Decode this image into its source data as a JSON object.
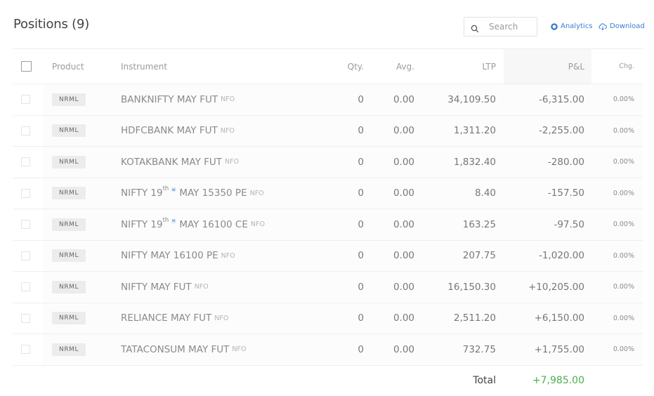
{
  "header": {
    "title": "Positions (9)",
    "search_placeholder": "Search",
    "analytics_label": "Analytics",
    "download_label": "Download"
  },
  "table": {
    "columns": {
      "product": "Product",
      "instrument": "Instrument",
      "qty": "Qty.",
      "avg": "Avg.",
      "ltp": "LTP",
      "pnl": "P&L",
      "chg": "Chg."
    },
    "rows": [
      {
        "product": "NRML",
        "pre": "BANKNIFTY MAY FUT",
        "sup": "",
        "weekly": false,
        "post": "",
        "exchange": "NFO",
        "qty": "0",
        "avg": "0.00",
        "ltp": "34,109.50",
        "pnl": "-6,315.00",
        "chg": "0.00%"
      },
      {
        "product": "NRML",
        "pre": "HDFCBANK MAY FUT",
        "sup": "",
        "weekly": false,
        "post": "",
        "exchange": "NFO",
        "qty": "0",
        "avg": "0.00",
        "ltp": "1,311.20",
        "pnl": "-2,255.00",
        "chg": "0.00%"
      },
      {
        "product": "NRML",
        "pre": "KOTAKBANK MAY FUT",
        "sup": "",
        "weekly": false,
        "post": "",
        "exchange": "NFO",
        "qty": "0",
        "avg": "0.00",
        "ltp": "1,832.40",
        "pnl": "-280.00",
        "chg": "0.00%"
      },
      {
        "product": "NRML",
        "pre": "NIFTY 19",
        "sup": "th",
        "weekly": true,
        "post": "MAY 15350 PE",
        "exchange": "NFO",
        "qty": "0",
        "avg": "0.00",
        "ltp": "8.40",
        "pnl": "-157.50",
        "chg": "0.00%"
      },
      {
        "product": "NRML",
        "pre": "NIFTY 19",
        "sup": "th",
        "weekly": true,
        "post": "MAY 16100 CE",
        "exchange": "NFO",
        "qty": "0",
        "avg": "0.00",
        "ltp": "163.25",
        "pnl": "-97.50",
        "chg": "0.00%"
      },
      {
        "product": "NRML",
        "pre": "NIFTY MAY 16100 PE",
        "sup": "",
        "weekly": false,
        "post": "",
        "exchange": "NFO",
        "qty": "0",
        "avg": "0.00",
        "ltp": "207.75",
        "pnl": "-1,020.00",
        "chg": "0.00%"
      },
      {
        "product": "NRML",
        "pre": "NIFTY MAY FUT",
        "sup": "",
        "weekly": false,
        "post": "",
        "exchange": "NFO",
        "qty": "0",
        "avg": "0.00",
        "ltp": "16,150.30",
        "pnl": "+10,205.00",
        "chg": "0.00%"
      },
      {
        "product": "NRML",
        "pre": "RELIANCE MAY FUT",
        "sup": "",
        "weekly": false,
        "post": "",
        "exchange": "NFO",
        "qty": "0",
        "avg": "0.00",
        "ltp": "2,511.20",
        "pnl": "+6,150.00",
        "chg": "0.00%"
      },
      {
        "product": "NRML",
        "pre": "TATACONSUM MAY FUT",
        "sup": "",
        "weekly": false,
        "post": "",
        "exchange": "NFO",
        "qty": "0",
        "avg": "0.00",
        "ltp": "732.75",
        "pnl": "+1,755.00",
        "chg": "0.00%"
      }
    ],
    "weekly_marker": "w",
    "total_label": "Total",
    "total_value": "+7,985.00"
  },
  "colors": {
    "accent": "#387ed1",
    "profit": "#4caf50",
    "text": "#444444",
    "muted": "#9b9b9b"
  },
  "icons": {
    "search": "search-icon",
    "analytics": "analytics-icon",
    "download": "cloud-download-icon"
  }
}
